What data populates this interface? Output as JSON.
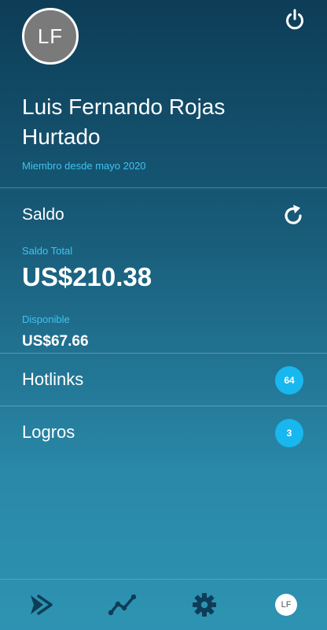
{
  "profile": {
    "initials": "LF",
    "name": "Luis Fernando Rojas Hurtado",
    "member_since": "Miembro desde mayo 2020"
  },
  "balance": {
    "title": "Saldo",
    "total_label": "Saldo Total",
    "total_value": "US$210.38",
    "available_label": "Disponible",
    "available_value": "US$67.66"
  },
  "list": [
    {
      "label": "Hotlinks",
      "count": "64"
    },
    {
      "label": "Logros",
      "count": "3"
    }
  ],
  "nav": {
    "items": [
      "forward-icon",
      "trend-icon",
      "gear-icon",
      "profile-avatar"
    ],
    "avatar_initials": "LF"
  },
  "colors": {
    "accent": "#3fc3f0",
    "badge": "#18b7ef",
    "bg_top": "#0d3d57",
    "bg_bottom": "#2e93b2"
  },
  "icons": {
    "header_right": "power-icon",
    "balance_action": "refresh-icon"
  }
}
